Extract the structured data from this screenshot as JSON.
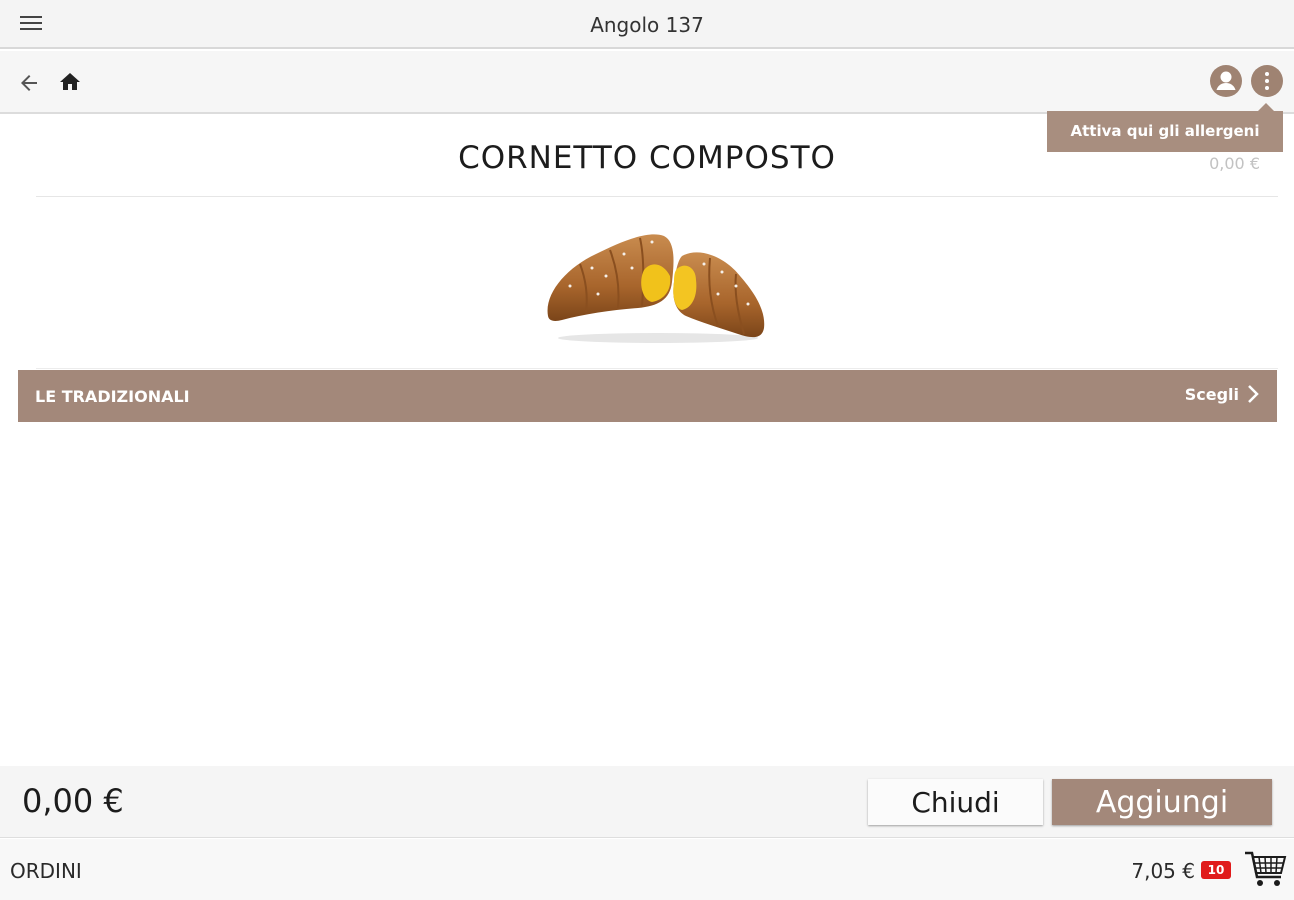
{
  "app": {
    "title": "Angolo 137"
  },
  "tooltip": {
    "text": "Attiva qui gli allergeni"
  },
  "product": {
    "title": "CORNETTO COMPOSTO",
    "price": "0,00 €"
  },
  "category": {
    "label": "LE TRADIZIONALI",
    "action": "Scegli"
  },
  "footer": {
    "total": "0,00 €",
    "close_label": "Chiudi",
    "add_label": "Aggiungi"
  },
  "orders": {
    "label": "ORDINI",
    "total": "7,05 €",
    "count": "10"
  },
  "colors": {
    "accent": "#a3887a",
    "badge": "#e01b1b",
    "background": "#ffffff"
  },
  "icons": [
    "menu-icon",
    "back-arrow-icon",
    "home-icon",
    "user-account-icon",
    "more-vertical-icon",
    "chevron-right-icon",
    "cart-icon"
  ]
}
